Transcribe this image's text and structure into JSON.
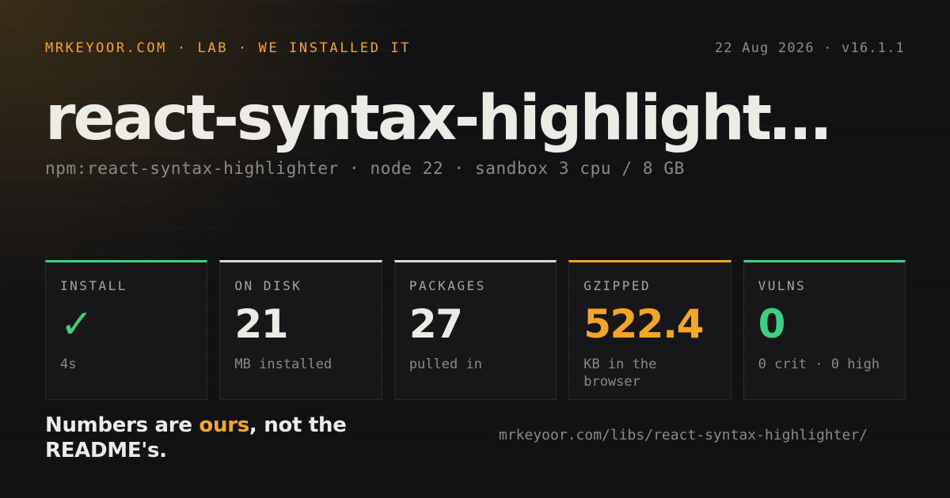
{
  "header": {
    "breadcrumb": "MRKEYOOR.COM · LAB · WE INSTALLED IT",
    "meta": "22 Aug 2026 · v16.1.1"
  },
  "title": "react-syntax-highlight…",
  "subtitle": "npm:react-syntax-highlighter · node 22 · sandbox 3 cpu / 8 GB",
  "colors": {
    "accent": "#f5a623",
    "good": "#3ecf80",
    "neutral": "#d9d7d1",
    "background": "#121214"
  },
  "cards": [
    {
      "label": "INSTALL",
      "value": "✓",
      "note": "4s",
      "accent": "#3ecf80",
      "value_color": "#3ecf80"
    },
    {
      "label": "ON DISK",
      "value": "21",
      "note": "MB installed",
      "accent": "#d9d7d1",
      "value_color": "#ecebe5"
    },
    {
      "label": "PACKAGES",
      "value": "27",
      "note": "pulled in",
      "accent": "#d9d7d1",
      "value_color": "#ecebe5"
    },
    {
      "label": "GZIPPED",
      "value": "522.4",
      "note": "KB in the browser",
      "accent": "#f5a623",
      "value_color": "#f5a623"
    },
    {
      "label": "VULNS",
      "value": "0",
      "note": "0 crit · 0 high",
      "accent": "#3ecf80",
      "value_color": "#3ecf80"
    }
  ],
  "footer": {
    "tagline_pre": "Numbers are ",
    "tagline_highlight": "ours",
    "tagline_post": ", not the README's.",
    "url": "mrkeyoor.com/libs/react-syntax-highlighter/"
  }
}
